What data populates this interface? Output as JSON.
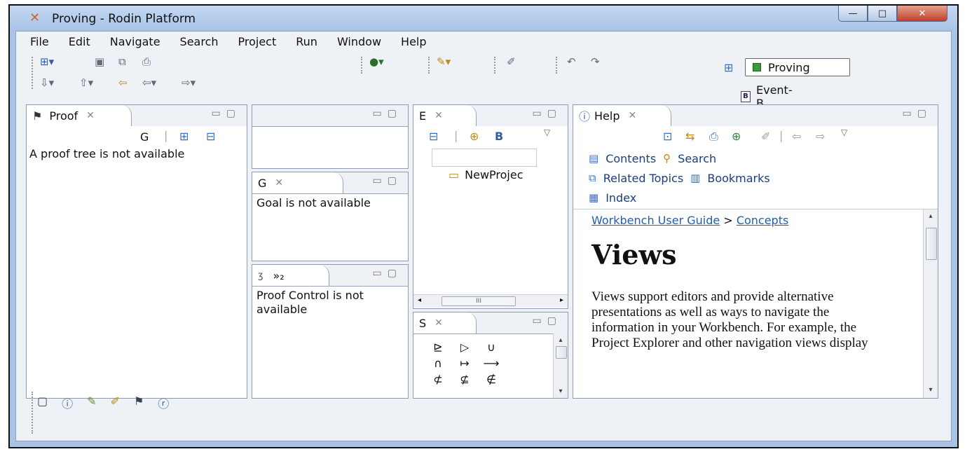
{
  "window": {
    "title": "Proving - Rodin Platform",
    "minimize_glyph": "—",
    "maximize_glyph": "□",
    "close_glyph": "✕"
  },
  "menubar": {
    "items": [
      "File",
      "Edit",
      "Navigate",
      "Search",
      "Project",
      "Run",
      "Window",
      "Help"
    ]
  },
  "perspectives": {
    "active": "Proving",
    "other": "Event-B"
  },
  "proof_tree_view": {
    "tab_label": "Proof",
    "tool_label": "G",
    "message": "A proof tree is not available"
  },
  "empty_view": {},
  "goal_view": {
    "tab_label": "G",
    "message": "Goal is not available"
  },
  "proof_control_view": {
    "tab_label": "»₂",
    "message": "Proof Control is not available"
  },
  "explorer_view": {
    "tab_label": "E",
    "project_item": "NewProjec",
    "scroll_mid": "III"
  },
  "symbols_view": {
    "tab_label": "S",
    "symbols": [
      "⊵",
      "▷",
      "∪",
      "∩",
      "↦",
      "⟶",
      "⊄",
      "⊈",
      "∉"
    ]
  },
  "help_view": {
    "tab_label": "Help",
    "nav": {
      "contents": "Contents",
      "search": "Search",
      "related": "Related Topics",
      "bookmarks": "Bookmarks",
      "index": "Index"
    },
    "breadcrumb_a": "Workbench User Guide",
    "breadcrumb_sep": ">",
    "breadcrumb_b": "Concepts",
    "heading": "Views",
    "body": "Views support editors and provide alternative presentations as well as ways to navigate the information in your Workbench. For example, the Project Explorer and other navigation views display"
  }
}
